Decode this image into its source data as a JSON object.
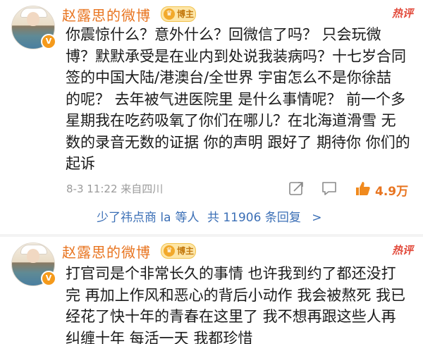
{
  "comments": [
    {
      "author": "赵露思的微博",
      "badge": "博主",
      "hot_label": "热评",
      "text": "你震惊什么？意外什么？回微信了吗？ 只会玩微\n博？默默承受是在业内到处说我装病吗？十七岁合同\n签的中国大陆/港澳台/全世界  宇宙怎么不是你徐喆\n的呢？ 去年被气进医院里 是什么事情呢？ 前一个多\n星期我在吃药吸氧了你们在哪儿？在北海道滑雪 无\n数的录音无数的证据 你的声明 跟好了 期待你 你们的\n起诉",
      "time": "8-3 11:22",
      "source": "来自四川",
      "likes": "4.9万",
      "reply_link": {
        "prefix": "少了祎点商 la",
        "middle": "等人",
        "count": "共 11906 条回复",
        "chevron": ">"
      }
    },
    {
      "author": "赵露思的微博",
      "badge": "博主",
      "hot_label": "热评",
      "text": "打官司是个非常长久的事情 也许我到约了都还没打\n完 再加上作风和恶心的背后小动作 我会被熬死 我已\n经花了快十年的青春在这里了 我不想再跟这些人再\n纠缠十年 每活一天 我都珍惜"
    }
  ],
  "icons": {
    "share": "share-icon",
    "comment": "comment-icon",
    "like": "thumbs-up-icon",
    "verified": "verified-v-icon"
  },
  "colors": {
    "author": "#e8741f",
    "hot": "#e24a3b",
    "link": "#3b6fb6",
    "meta": "#9b9b9b"
  }
}
